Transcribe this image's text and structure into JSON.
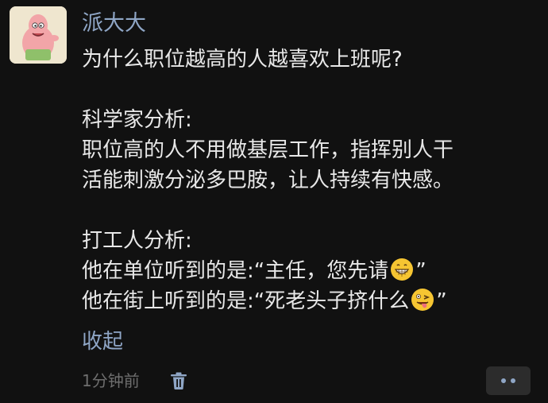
{
  "post": {
    "author": "派大大",
    "lines": {
      "l1": "为什么职位越高的人越喜欢上班呢?",
      "l2": "科学家分析:",
      "l3": "职位高的人不用做基层工作，指挥别人干",
      "l4": "活能刺激分泌多巴胺，让人持续有快感。",
      "l5": "打工人分析:",
      "l6_before": "他在单位听到的是:“主任，您先请",
      "l6_after": "”",
      "l7_before": "他在街上听到的是:“死老头子挤什么",
      "l7_after": "”"
    },
    "emoji": {
      "grin": "grinning-emoji-icon",
      "tongue": "zany-tongue-emoji-icon"
    },
    "collapse_label": "收起",
    "timestamp": "1分钟前"
  },
  "actions": {
    "delete_icon": "trash-icon",
    "more_icon": "more-dots-icon"
  },
  "colors": {
    "background": "#111111",
    "text": "#e8e8e8",
    "link": "#8fa6c6",
    "muted": "#6e6e6e"
  }
}
